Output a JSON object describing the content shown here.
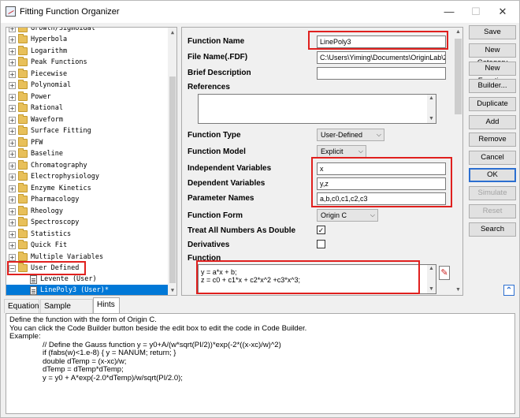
{
  "window": {
    "title": "Fitting Function Organizer",
    "controls": {
      "minimize": "—",
      "maximize": "☐",
      "close": "✕"
    }
  },
  "tree": {
    "top_partial": "Growth/Sigmoidal",
    "items": [
      {
        "label": "Hyperbola"
      },
      {
        "label": "Logarithm"
      },
      {
        "label": "Peak Functions"
      },
      {
        "label": "Piecewise"
      },
      {
        "label": "Polynomial"
      },
      {
        "label": "Power"
      },
      {
        "label": "Rational"
      },
      {
        "label": "Waveform"
      },
      {
        "label": "Surface Fitting"
      },
      {
        "label": "PFW"
      },
      {
        "label": "Baseline"
      },
      {
        "label": "Chromatography"
      },
      {
        "label": "Electrophysiology"
      },
      {
        "label": "Enzyme Kinetics"
      },
      {
        "label": "Pharmacology"
      },
      {
        "label": "Rheology"
      },
      {
        "label": "Spectroscopy"
      },
      {
        "label": "Statistics"
      },
      {
        "label": "Quick Fit"
      },
      {
        "label": "Multiple Variables"
      }
    ],
    "expanded": {
      "label": "User Defined",
      "expander": "−"
    },
    "children": [
      {
        "label": "Levente (User)"
      },
      {
        "label": "LinePoly3 (User)*"
      }
    ],
    "collapsed_expander": "+"
  },
  "props": {
    "function_name_label": "Function Name",
    "function_name_value": "LinePoly3",
    "file_name_label": "File Name(.FDF)",
    "file_name_value": "C:\\Users\\Yiming\\Documents\\OriginLab\\2",
    "brief_desc_label": "Brief Description",
    "brief_desc_value": "",
    "references_label": "References",
    "references_value": "",
    "function_type_label": "Function Type",
    "function_type_value": "User-Defined",
    "function_model_label": "Function Model",
    "function_model_value": "Explicit",
    "indep_vars_label": "Independent Variables",
    "indep_vars_value": "x",
    "dep_vars_label": "Dependent Variables",
    "dep_vars_value": "y,z",
    "param_names_label": "Parameter Names",
    "param_names_value": "a,b,c0,c1,c2,c3",
    "function_form_label": "Function Form",
    "function_form_value": "Origin C",
    "treat_all_label": "Treat All Numbers As Double",
    "treat_all_check": "✓",
    "derivatives_label": "Derivatives",
    "derivatives_check": "",
    "function_label": "Function",
    "function_line1": "y = a*x + b;",
    "function_line2": "z = c0 + c1*x + c2*x^2 +c3*x^3;"
  },
  "buttons": {
    "save": "Save",
    "new_category": "New Category",
    "new_function": "New Function",
    "builder": "Builder...",
    "duplicate": "Duplicate",
    "add": "Add",
    "remove": "Remove",
    "cancel": "Cancel",
    "ok": "OK",
    "simulate": "Simulate",
    "reset": "Reset",
    "search": "Search"
  },
  "tabs": [
    {
      "label": "Equation"
    },
    {
      "label": "Sample Curve"
    },
    {
      "label": "Hints"
    }
  ],
  "hints": {
    "lines": [
      "Define the function with the form of Origin C.",
      "You can click the Code Builder button beside the edit box to edit the code in Code Builder.",
      "Example:"
    ],
    "code": [
      "// Define the Gauss function y = y0+A/(w*sqrt(PI/2))*exp(-2*((x-xc)/w)^2)",
      "if (fabs(w)<1.e-8) { y = NANUM; return; }",
      "double dTemp = (x-xc)/w;",
      "dTemp = dTemp*dTemp;",
      "y = y0 + A*exp(-2.0*dTemp)/w/sqrt(PI/2.0);"
    ]
  },
  "icons": {
    "scroll_up": "▲",
    "scroll_down": "▼",
    "combo_arrow": "⌵",
    "expand_panel": "⌃",
    "code_builder": "✎"
  },
  "colors": {
    "highlight": "#e0201e",
    "selection": "#0078d7",
    "default_button_border": "#2c6fd0"
  }
}
